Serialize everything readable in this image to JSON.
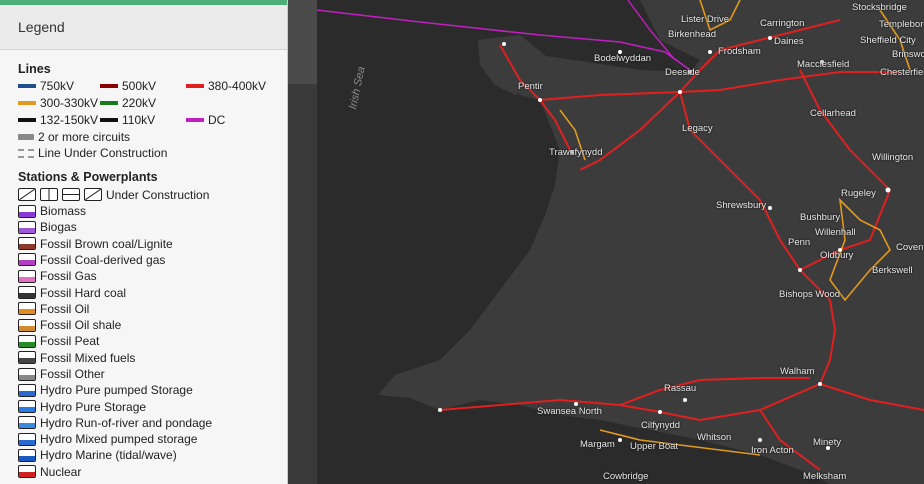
{
  "legend": {
    "title": "Legend",
    "lines_title": "Lines",
    "lines": [
      {
        "label": "750kV",
        "color": "#1f4e8c"
      },
      {
        "label": "500kV",
        "color": "#8b0000"
      },
      {
        "label": "380-400kV",
        "color": "#e02020"
      },
      {
        "label": "300-330kV",
        "color": "#e09a20"
      },
      {
        "label": "220kV",
        "color": "#1a7a1a"
      },
      {
        "label": "132-150kV",
        "color": "#111111"
      },
      {
        "label": "110kV",
        "color": "#111111"
      },
      {
        "label": "DC",
        "color": "#c020c0"
      }
    ],
    "circuits_label": "2 or more circuits",
    "construction_label": "Line Under Construction",
    "stations_title": "Stations & Powerplants",
    "under_construction_label": "Under Construction",
    "stations": [
      {
        "label": "Biomass",
        "color": "#8a3ad6"
      },
      {
        "label": "Biogas",
        "color": "#a05ad8"
      },
      {
        "label": "Fossil Brown coal/Lignite",
        "color": "#8b3a2a"
      },
      {
        "label": "Fossil Coal-derived gas",
        "color": "#b040c0"
      },
      {
        "label": "Fossil Gas",
        "color": "#e070c0"
      },
      {
        "label": "Fossil Hard coal",
        "color": "#333333"
      },
      {
        "label": "Fossil Oil",
        "color": "#e08a20"
      },
      {
        "label": "Fossil Oil shale",
        "color": "#d08a30"
      },
      {
        "label": "Fossil Peat",
        "color": "#2a8a2a"
      },
      {
        "label": "Fossil Mixed fuels",
        "color": "#444444"
      },
      {
        "label": "Fossil Other",
        "color": "#888888"
      },
      {
        "label": "Hydro Pure pumped Storage",
        "color": "#2a6ad0"
      },
      {
        "label": "Hydro Pure Storage",
        "color": "#2a7ae0"
      },
      {
        "label": "Hydro Run-of-river and pondage",
        "color": "#3a8ae0"
      },
      {
        "label": "Hydro Mixed pumped storage",
        "color": "#2a6ad0"
      },
      {
        "label": "Hydro Marine (tidal/wave)",
        "color": "#1a5ac0"
      },
      {
        "label": "Nuclear",
        "color": "#d02020"
      }
    ]
  },
  "map": {
    "sea_label": "Irish Sea",
    "places": [
      "Lister Drive",
      "Carrington",
      "Stocksbridge",
      "Templeborough",
      "Birkenhead",
      "Daines",
      "Sheffield City",
      "Brinsworth",
      "Bodelwyddan",
      "Frodsham",
      "Chesterfield",
      "Pentir",
      "Deeside",
      "Macclesfield",
      "Legacy",
      "Cellarhead",
      "Trawsfynydd",
      "Willington",
      "Rugeley",
      "Shrewsbury",
      "Bushbury",
      "Willenhall",
      "Coventry",
      "Penn",
      "Oldbury",
      "Berkswell",
      "Bishops Wood",
      "Walham",
      "Rassau",
      "Swansea North",
      "Cilfynydd",
      "Whitson",
      "Margam",
      "Upper Boat",
      "Iron Acton",
      "Minety",
      "Cowbridge",
      "Melksham"
    ]
  }
}
